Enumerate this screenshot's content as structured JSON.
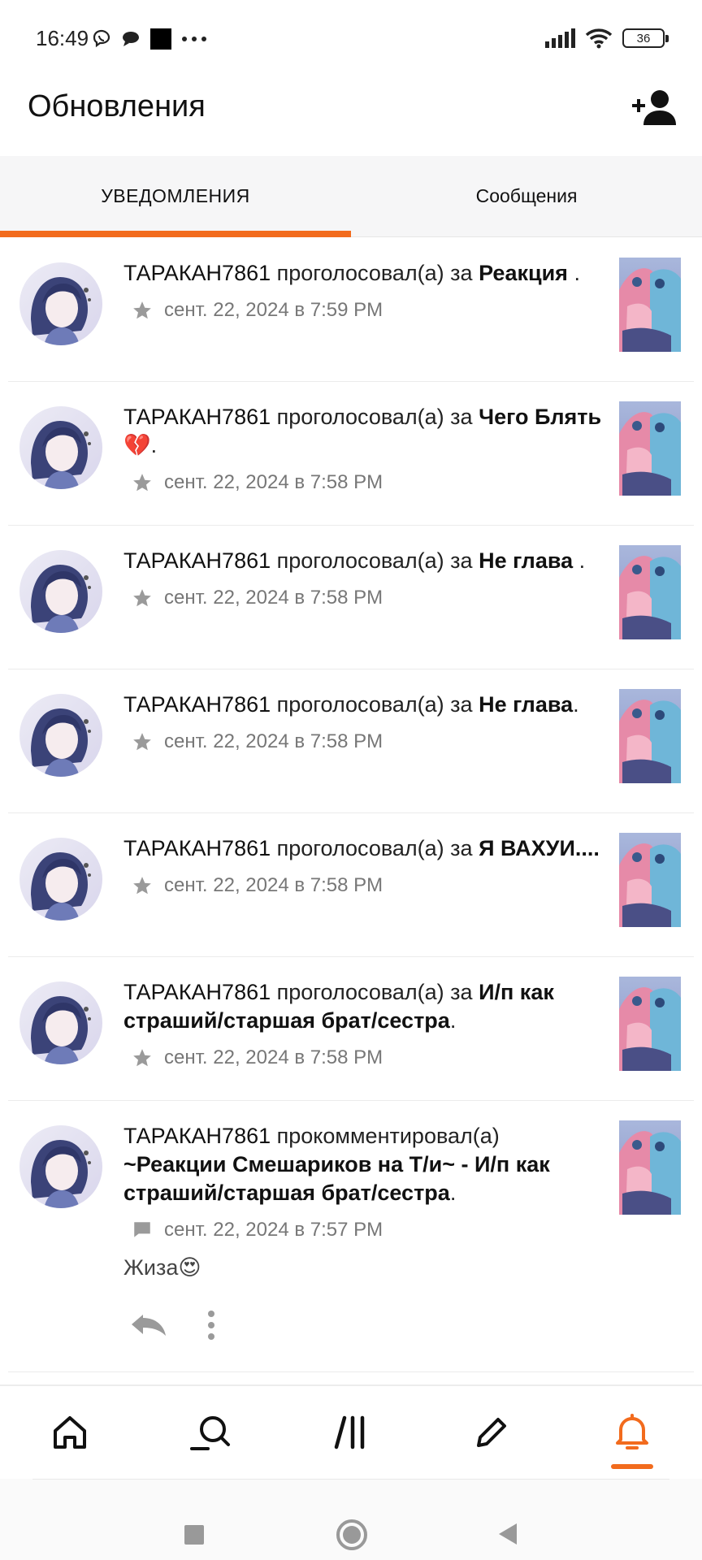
{
  "status_bar": {
    "time": "16:49",
    "battery": "36",
    "icons_left": [
      "viber-icon",
      "chat-bubble-icon",
      "black-square-icon",
      "more-dots-icon"
    ],
    "icons_right": [
      "signal-icon",
      "wifi-icon",
      "battery-icon"
    ]
  },
  "header": {
    "title": "Обновления",
    "add_user_icon": "add-user-icon"
  },
  "tabs": [
    {
      "label": "УВЕДОМЛЕНИЯ",
      "active": true
    },
    {
      "label": "Сообщения",
      "active": false
    }
  ],
  "colors": {
    "accent": "#f26b1d",
    "meta_text": "#777777",
    "divider": "#ececec"
  },
  "notifications": [
    {
      "user": "ТАРАКАН7861",
      "action": "проголосовал(а) за",
      "title": "Реакция",
      "suffix": " .",
      "meta_icon": "star-icon",
      "date": "сент. 22, 2024 в 7:59 PM"
    },
    {
      "user": "ТАРАКАН7861",
      "action": "проголосовал(а) за",
      "title": "Чего Блять 💔",
      "suffix": ".",
      "meta_icon": "star-icon",
      "date": "сент. 22, 2024 в 7:58 PM"
    },
    {
      "user": "ТАРАКАН7861",
      "action": "проголосовал(а) за",
      "title": "Не глава",
      "suffix": " .",
      "meta_icon": "star-icon",
      "date": "сент. 22, 2024 в 7:58 PM"
    },
    {
      "user": "ТАРАКАН7861",
      "action": "проголосовал(а) за",
      "title": "Не глава",
      "suffix": ".",
      "meta_icon": "star-icon",
      "date": "сент. 22, 2024 в 7:58 PM"
    },
    {
      "user": "ТАРАКАН7861",
      "action": "проголосовал(а) за",
      "title": "Я ВАХУИ....",
      "suffix": "",
      "meta_icon": "star-icon",
      "date": "сент. 22, 2024 в 7:58 PM"
    },
    {
      "user": "ТАРАКАН7861",
      "action": "проголосовал(а) за",
      "title": "И/п как страший/старшая брат/сестра",
      "suffix": ".",
      "meta_icon": "star-icon",
      "date": "сент. 22, 2024 в 7:58 PM"
    }
  ],
  "comment": {
    "user": "ТАРАКАН7861",
    "action": "прокомментировал(а)",
    "title": "~Реакции Смешариков на Т/и~ - И/п как страший/старшая брат/сестра",
    "suffix": ".",
    "meta_icon": "comment-icon",
    "date": "сент. 22, 2024 в 7:57 PM",
    "text": "Жиза😍",
    "actions": [
      "reply-icon",
      "more-vertical-icon"
    ]
  },
  "bottom_nav": [
    {
      "icon": "home-icon",
      "active": false
    },
    {
      "icon": "search-icon",
      "active": false
    },
    {
      "icon": "library-icon",
      "active": false
    },
    {
      "icon": "write-icon",
      "active": false
    },
    {
      "icon": "bell-icon",
      "active": true
    }
  ],
  "system_nav": [
    "recents-square-icon",
    "home-circle-icon",
    "back-triangle-icon"
  ]
}
